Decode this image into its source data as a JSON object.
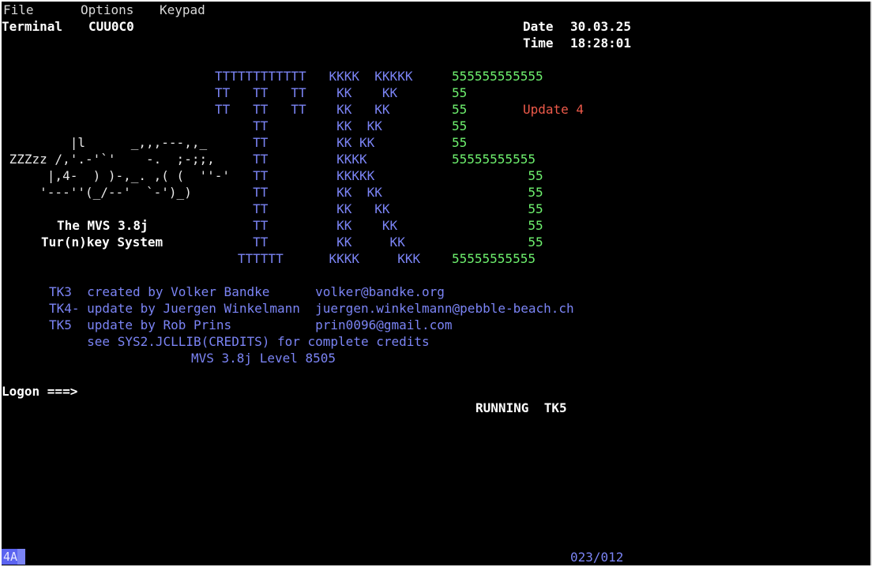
{
  "menu": {
    "file": "File",
    "options": "Options",
    "keypad": "Keypad"
  },
  "header": {
    "terminal_label": "Terminal",
    "terminal_id": "CUU0C0",
    "date_label": "Date",
    "date_value": "30.03.25",
    "time_label": "Time",
    "time_value": "18:28:01"
  },
  "banner": {
    "tk_rows": [
      "TTTTTTTTTTTT   KKKK  KKKKK",
      "TT   TT   TT    KK    KK",
      "TT   TT   TT    KK   KK",
      "     TT         KK  KK",
      "     TT         KK KK",
      "     TT         KKKK",
      "     TT         KKKKK",
      "     TT         KK  KK",
      "     TT         KK   KK",
      "     TT         KK    KK",
      "     TT         KK     KK",
      "   TTTTTT      KKKK     KKK"
    ],
    "five_rows": [
      "555555555555",
      "55",
      "55",
      "55",
      "55",
      "55555555555",
      "          55",
      "          55",
      "          55",
      "          55",
      "          55",
      "55555555555"
    ],
    "update_label": "Update 4"
  },
  "art": {
    "lines": [
      "         |l      _,,,---,,_",
      " ZZZzz /,'.-'`'    -.  ;-;;,",
      "      |,4-  ) )-,_. ,( (  ''-'",
      "     '---''(_/--'  `-')_)"
    ],
    "title_line1": "The MVS 3.8j",
    "title_line2": "Tur(n)key System"
  },
  "credits": {
    "line1": "TK3  created by Volker Bandke      volker@bandke.org",
    "line2": "TK4- update by Juergen Winkelmann  juergen.winkelmann@pebble-beach.ch",
    "line3": "TK5  update by Rob Prins           prin0096@gmail.com",
    "line4": "     see SYS2.JCLLIB(CREDITS) for complete credits",
    "line5": "MVS 3.8j Level 8505"
  },
  "logon": {
    "prompt": "Logon ===>",
    "value": ""
  },
  "status_text": "RUNNING  TK5",
  "oia": {
    "indicator": "4A",
    "cursor_position": "023/012"
  },
  "colors": {
    "background": "#000000",
    "white": "#ffffff",
    "blue": "#7b84f5",
    "green": "#6ef16e",
    "red": "#ee5a4a"
  }
}
